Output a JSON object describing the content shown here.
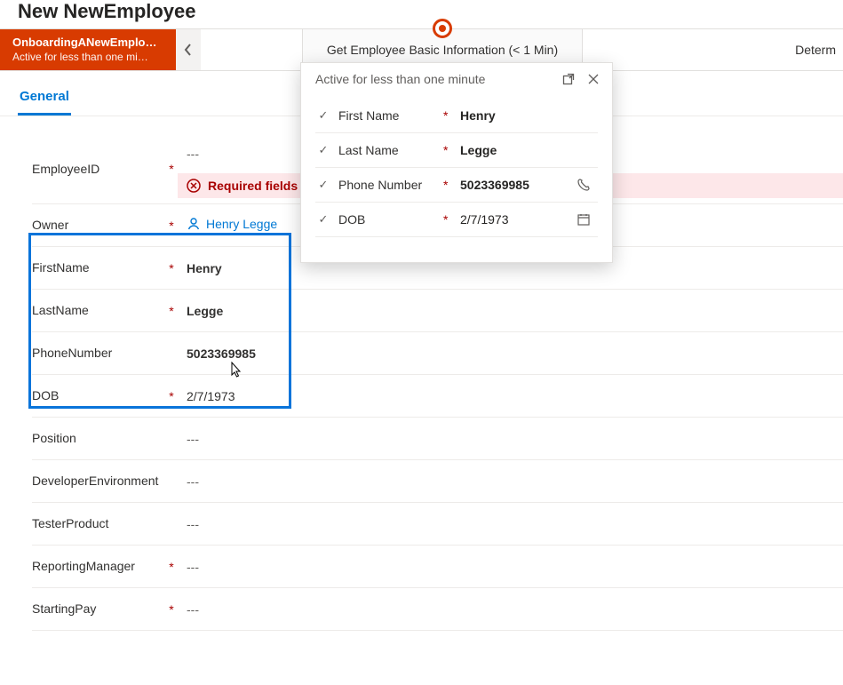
{
  "page": {
    "title": "New NewEmployee"
  },
  "stages": {
    "active": {
      "name": "OnboardingANewEmplo…",
      "status": "Active for less than one mi…"
    },
    "current": "Get Employee Basic Information  (< 1 Min)",
    "next": "Determ"
  },
  "tabs": {
    "general": "General"
  },
  "form": {
    "empty": "---",
    "employeeId": {
      "label": "EmployeeID"
    },
    "errorBanner": "Required fields",
    "owner": {
      "label": "Owner",
      "value": "Henry Legge"
    },
    "firstName": {
      "label": "FirstName",
      "value": "Henry"
    },
    "lastName": {
      "label": "LastName",
      "value": "Legge"
    },
    "phone": {
      "label": "PhoneNumber",
      "value": "5023369985"
    },
    "dob": {
      "label": "DOB",
      "value": "2/7/1973"
    },
    "position": {
      "label": "Position"
    },
    "devEnv": {
      "label": "DeveloperEnvironment"
    },
    "tester": {
      "label": "TesterProduct"
    },
    "manager": {
      "label": "ReportingManager"
    },
    "pay": {
      "label": "StartingPay"
    }
  },
  "flyout": {
    "title": "Active for less than one minute",
    "firstName": {
      "label": "First Name",
      "value": "Henry"
    },
    "lastName": {
      "label": "Last Name",
      "value": "Legge"
    },
    "phone": {
      "label": "Phone Number",
      "value": "5023369985"
    },
    "dob": {
      "label": "DOB",
      "value": "2/7/1973"
    }
  },
  "colors": {
    "accent": "#d83b01",
    "link": "#0078d4",
    "error": "#a80000",
    "highlight": "#0a74da"
  }
}
